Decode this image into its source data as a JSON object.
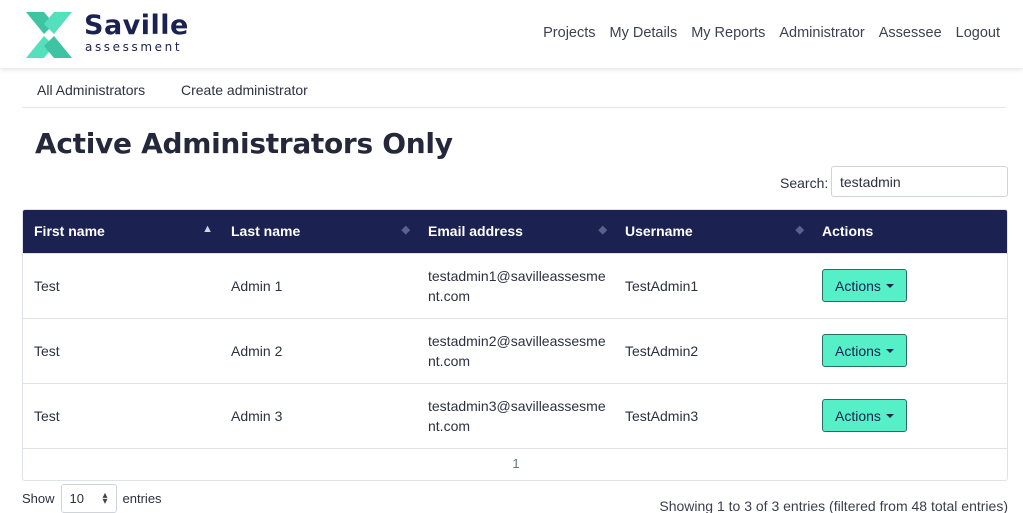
{
  "brand": {
    "name": "Saville",
    "subtitle": "assessment",
    "colors": {
      "navy": "#1b2150",
      "teal": "#3ec3a3",
      "accent": "#55f0c8"
    }
  },
  "nav": [
    "Projects",
    "My Details",
    "My Reports",
    "Administrator",
    "Assessee",
    "Logout"
  ],
  "subnav": [
    "All Administrators",
    "Create administrator"
  ],
  "page_title": "Active Administrators Only",
  "search": {
    "label": "Search:",
    "value": "testadmin"
  },
  "table": {
    "headers": [
      "First name",
      "Last name",
      "Email address",
      "Username",
      "Actions"
    ],
    "rows": [
      {
        "first": "Test",
        "last": "Admin 1",
        "email_line1": "testadmin1@savilleassesme",
        "email_line2": "nt.com",
        "username": "TestAdmin1",
        "action": "Actions"
      },
      {
        "first": "Test",
        "last": "Admin 2",
        "email_line1": "testadmin2@savilleassesme",
        "email_line2": "nt.com",
        "username": "TestAdmin2",
        "action": "Actions"
      },
      {
        "first": "Test",
        "last": "Admin 3",
        "email_line1": "testadmin3@savilleassesme",
        "email_line2": "nt.com",
        "username": "TestAdmin3",
        "action": "Actions"
      }
    ],
    "page": "1"
  },
  "length": {
    "show": "Show",
    "value": "10",
    "entries": "entries"
  },
  "info": "Showing 1 to 3 of 3 entries (filtered from 48 total entries)"
}
